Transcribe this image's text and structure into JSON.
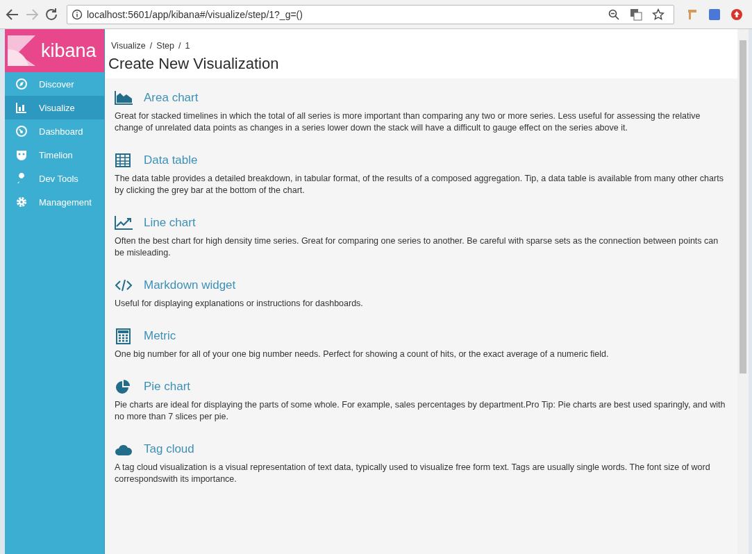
{
  "browser": {
    "url": "localhost:5601/app/kibana#/visualize/step/1?_g=()"
  },
  "sidebar": {
    "logo": "kibana",
    "items": [
      {
        "label": "Discover",
        "selected": false
      },
      {
        "label": "Visualize",
        "selected": true
      },
      {
        "label": "Dashboard",
        "selected": false
      },
      {
        "label": "Timelion",
        "selected": false
      },
      {
        "label": "Dev Tools",
        "selected": false
      },
      {
        "label": "Management",
        "selected": false
      }
    ]
  },
  "breadcrumbs": [
    {
      "label": "Visualize",
      "separator": "/"
    },
    {
      "label": "Step",
      "separator": "/"
    },
    {
      "label": "1"
    }
  ],
  "page_title": "Create New Visualization",
  "visualizations": [
    {
      "kind": "area",
      "name": "Area chart",
      "description": "Great for stacked timelines in which the total of all series is more important than comparing any two or more series. Less useful for assessing the relative change of unrelated data points as changes in a series lower down the stack will have a difficult to gauge effect on the series above it."
    },
    {
      "kind": "table",
      "name": "Data table",
      "description": "The data table provides a detailed breakdown, in tabular format, of the results of a composed aggregation. Tip, a data table is available from many other charts by clicking the grey bar at the bottom of the chart."
    },
    {
      "kind": "line",
      "name": "Line chart",
      "description": "Often the best chart for high density time series. Great for comparing one series to another. Be careful with sparse sets as the connection between points can be misleading."
    },
    {
      "kind": "code",
      "name": "Markdown widget",
      "description": "Useful for displaying explanations or instructions for dashboards."
    },
    {
      "kind": "calculator",
      "name": "Metric",
      "description": "One big number for all of your one big number needs. Perfect for showing a count of hits, or the exact average of a numeric field."
    },
    {
      "kind": "pie",
      "name": "Pie chart",
      "description": "Pie charts are ideal for displaying the parts of some whole. For example, sales percentages by department.Pro Tip: Pie charts are best used sparingly, and with no more than 7 slices per pie."
    },
    {
      "kind": "cloud",
      "name": "Tag cloud",
      "description": "A tag cloud visualization is a visual representation of text data, typically used to visualize free form text. Tags are usually single words. The font size of word correspondswith its importance."
    }
  ]
}
